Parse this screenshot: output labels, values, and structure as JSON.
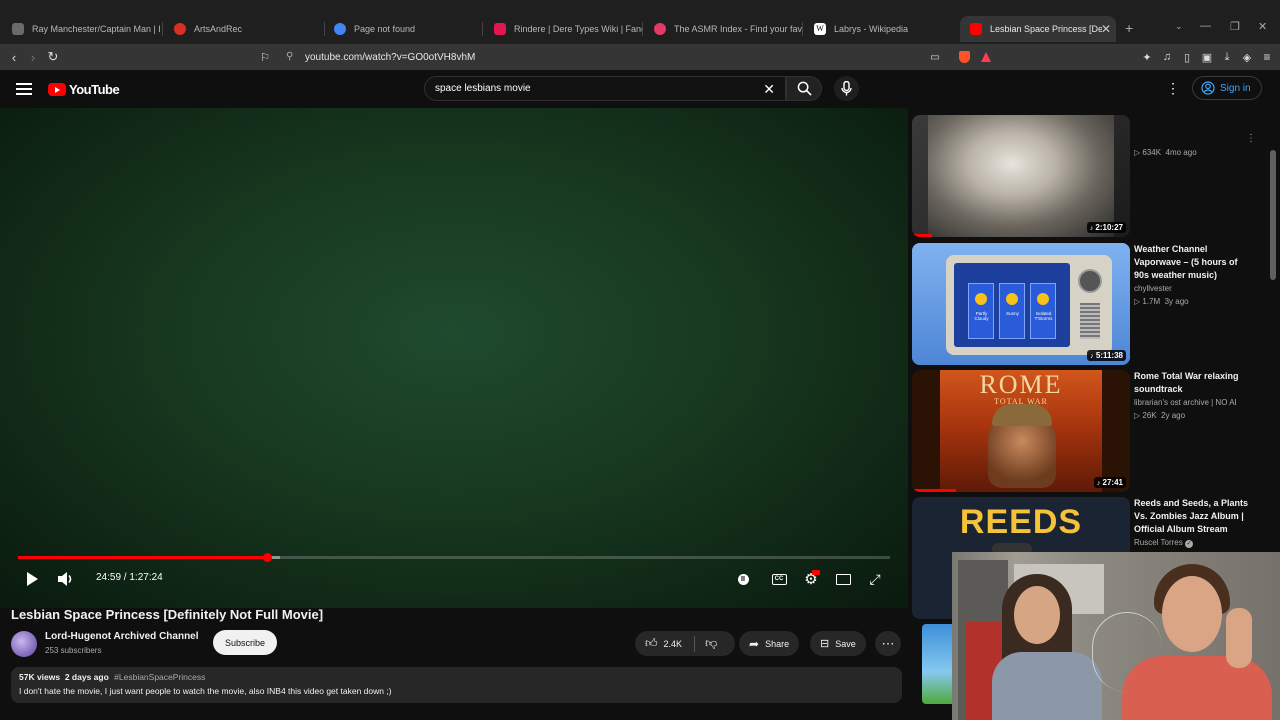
{
  "browser": {
    "tabs": [
      {
        "title": "Ray Manchester/Captain Man | Hen",
        "color": "#6a6a6a"
      },
      {
        "title": "ArtsAndRec",
        "color": "#d93025"
      },
      {
        "title": "Page not found",
        "color": "#4285f4"
      },
      {
        "title": "Rindere | Dere Types Wiki | Fandom",
        "color": "#e2174f"
      },
      {
        "title": "The ASMR Index - Find your favorit",
        "color": "#e33b66"
      },
      {
        "title": "Labrys - Wikipedia",
        "color": "#ffffff"
      },
      {
        "title": "Lesbian Space Princess [Definit",
        "color": "#ff0000"
      }
    ],
    "url": "youtube.com/watch?v=GO0otVH8vhM"
  },
  "youtube": {
    "logo_text": "YouTube",
    "search_value": "space lesbians movie",
    "signin_label": "Sign in"
  },
  "player": {
    "time_current": "24:59",
    "time_total": "1:27:24",
    "time_display": "24:59 / 1:27:24",
    "progress_fraction": 0.286,
    "buffered_fraction": 0.3
  },
  "video": {
    "title": "Lesbian Space Princess [Definitely Not Full Movie]",
    "channel": "Lord-Hugenot Archived Channel",
    "subscribers": "253 subscribers",
    "subscribe_label": "Subscribe",
    "likes": "2.4K",
    "share_label": "Share",
    "save_label": "Save",
    "views_date": "57K views  2 days ago",
    "hashtag": "#LesbianSpacePrincess",
    "description": "I don't hate the movie, I just want people to watch the movie, also INB4 this video get taken down ;)"
  },
  "recommendations": [
    {
      "title": "",
      "channel": "",
      "stats": "634K  4mo ago",
      "duration": "2:10:27",
      "watched": 0.1
    },
    {
      "title": "Weather Channel Vaporwave – (5 hours of 90s weather music)",
      "channel": "chyllvester",
      "stats": "1.7M  3y ago",
      "duration": "5:11:38",
      "watched": 0.0
    },
    {
      "title": "Rome Total War relaxing soundtrack",
      "channel": "librarian's ost archive | NO AI",
      "stats": "26K  2y ago",
      "duration": "27:41",
      "watched": 0.2
    },
    {
      "title": "Reeds and Seeds, a Plants Vs. Zombies Jazz Album | Official Album Stream",
      "channel": "Ruscel Torres",
      "stats": "",
      "duration": "",
      "watched": 0.0
    }
  ],
  "thumb_text": {
    "rome_title": "ROME",
    "rome_sub": "TOTAL WAR",
    "reeds": "REEDS",
    "weather_labels": [
      "Partly Cloudy",
      "Sunny",
      "Isolated T'Storms"
    ]
  }
}
